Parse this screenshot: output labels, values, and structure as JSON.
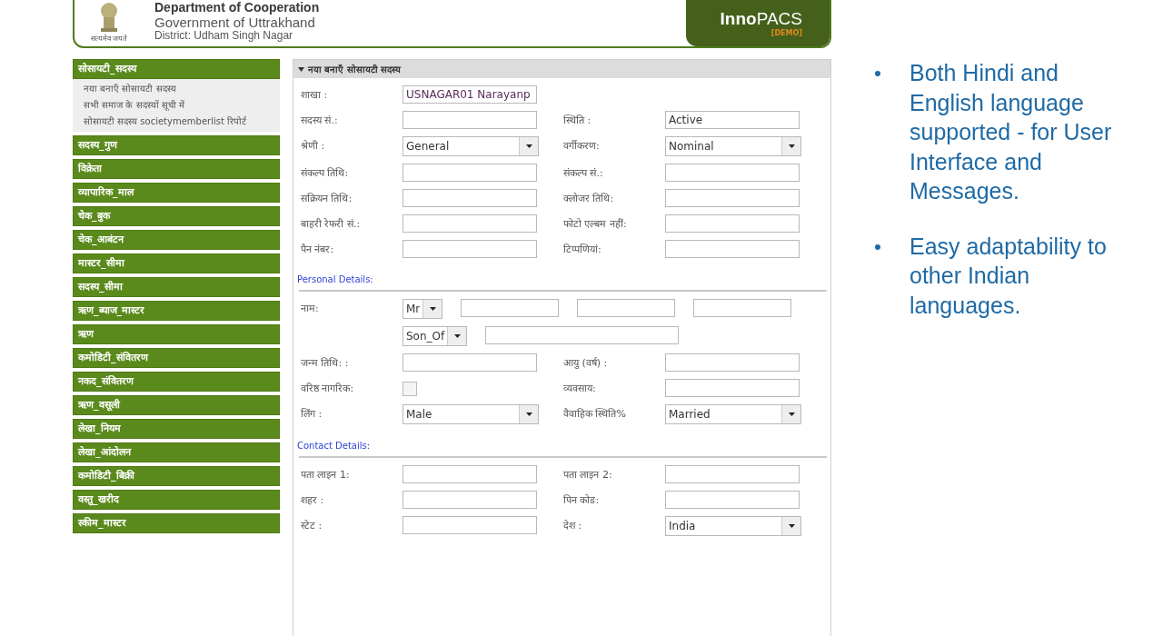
{
  "header": {
    "title": "Department of Cooperation",
    "subtitle": "Government of Uttrakhand",
    "district": "District: Udham Singh Nagar",
    "emblem_caption": "सत्यमेव जयते",
    "brand": {
      "bold": "Inno",
      "light": "PACS",
      "tag": "[DEMO]"
    }
  },
  "sidebar": [
    {
      "label": "सोसायटी_सदस्य",
      "children": [
        "नया बनाएँ सोसायटी सदस्य",
        "सभी समाज के सदस्यों सूची में",
        "सोसायटी सदस्य societymemberlist रिपोर्ट"
      ]
    },
    {
      "label": "सदस्य_गुण"
    },
    {
      "label": "विक्रेता"
    },
    {
      "label": "व्यापारिक_माल"
    },
    {
      "label": "चेक_बुक"
    },
    {
      "label": "चेक_आबंटन"
    },
    {
      "label": "मास्टर_सीमा"
    },
    {
      "label": "सदस्य_सीमा"
    },
    {
      "label": "ऋण_ब्याज_मास्टर"
    },
    {
      "label": "ऋण"
    },
    {
      "label": "कमोडिटी_संवितरण"
    },
    {
      "label": "नकद_संवितरण"
    },
    {
      "label": "ऋण_वसूली"
    },
    {
      "label": "लेखा_नियम"
    },
    {
      "label": "लेखा_आंदोलन"
    },
    {
      "label": "कमोडिटी_बिक्री"
    },
    {
      "label": "वस्तु_खरीद"
    },
    {
      "label": "स्कीम_मास्टर"
    }
  ],
  "form": {
    "title": "नया बनाएँ सोसायटी सदस्य",
    "sections": [
      {
        "rows": [
          {
            "kind": "pair",
            "fields": [
              {
                "label": "शाखा :",
                "control": {
                  "kind": "text",
                  "value": "USNAGAR01 Narayanp"
                }
              }
            ]
          },
          {
            "kind": "pair",
            "fields": [
              {
                "label": "सदस्य सं.:",
                "control": {
                  "kind": "text"
                }
              },
              {
                "label": "स्थिति :",
                "control": {
                  "kind": "text",
                  "value": "Active"
                }
              }
            ]
          },
          {
            "kind": "pair",
            "fields": [
              {
                "label": "श्रेणी :",
                "control": {
                  "kind": "select",
                  "value": "General"
                }
              },
              {
                "label": "वर्गीकरण:",
                "control": {
                  "kind": "select",
                  "value": "Nominal"
                }
              }
            ]
          },
          {
            "kind": "pair",
            "fields": [
              {
                "label": "संकल्प तिथि:",
                "control": {
                  "kind": "text"
                }
              },
              {
                "label": "संकल्प सं.:",
                "control": {
                  "kind": "text"
                }
              }
            ]
          },
          {
            "kind": "pair",
            "fields": [
              {
                "label": "सक्रियन तिथि:",
                "control": {
                  "kind": "text"
                }
              },
              {
                "label": "क्लोजर तिथि:",
                "control": {
                  "kind": "text"
                }
              }
            ]
          },
          {
            "kind": "pair",
            "fields": [
              {
                "label": "बाहरी रेफरी सं.:",
                "control": {
                  "kind": "text"
                }
              },
              {
                "label": "फोटो एल्बम नहीं:",
                "control": {
                  "kind": "text"
                }
              }
            ]
          },
          {
            "kind": "pair",
            "fields": [
              {
                "label": "पैन नंबर:",
                "control": {
                  "kind": "text"
                }
              },
              {
                "label": "टिप्पणियां:",
                "control": {
                  "kind": "text"
                }
              }
            ]
          }
        ]
      },
      {
        "heading": "Personal Details:",
        "rows": [
          {
            "kind": "wide",
            "label": "नाम:",
            "controls": [
              {
                "kind": "select",
                "value": "Mr"
              },
              {
                "kind": "text"
              },
              {
                "kind": "text"
              },
              {
                "kind": "text"
              }
            ]
          },
          {
            "kind": "wide",
            "controls": [
              {
                "kind": "select",
                "value": "Son_Of"
              },
              {
                "kind": "text"
              }
            ]
          },
          {
            "kind": "pair",
            "fields": [
              {
                "label": "जन्म तिथि: :",
                "control": {
                  "kind": "text"
                }
              },
              {
                "label": "आयु (वर्ष) :",
                "control": {
                  "kind": "text"
                }
              }
            ]
          },
          {
            "kind": "pair",
            "fields": [
              {
                "label": "वरिष्ठ नागरिक:",
                "control": {
                  "kind": "checkbox",
                  "checked": false
                }
              },
              {
                "label": "व्यवसाय:",
                "control": {
                  "kind": "text"
                }
              }
            ]
          },
          {
            "kind": "pair",
            "fields": [
              {
                "label": "लिंग :",
                "control": {
                  "kind": "select",
                  "value": "Male"
                }
              },
              {
                "label": "वैवाहिक स्थिति%",
                "control": {
                  "kind": "select",
                  "value": "Married"
                }
              }
            ]
          }
        ]
      },
      {
        "heading": "Contact Details:",
        "rows": [
          {
            "kind": "pair",
            "fields": [
              {
                "label": "पता लाइन 1:",
                "control": {
                  "kind": "text"
                }
              },
              {
                "label": "पता लाइन 2:",
                "control": {
                  "kind": "text"
                }
              }
            ]
          },
          {
            "kind": "pair",
            "fields": [
              {
                "label": "शहर :",
                "control": {
                  "kind": "text"
                }
              },
              {
                "label": "पिन कोड:",
                "control": {
                  "kind": "text"
                }
              }
            ]
          },
          {
            "kind": "pair",
            "fields": [
              {
                "label": "स्टेट :",
                "control": {
                  "kind": "text"
                }
              },
              {
                "label": "देश :",
                "control": {
                  "kind": "select",
                  "value": "India"
                }
              }
            ]
          }
        ]
      }
    ]
  },
  "bullets": [
    "Both Hindi and English language supported  - for User Interface and Messages.",
    "Easy adaptability to other Indian languages."
  ]
}
